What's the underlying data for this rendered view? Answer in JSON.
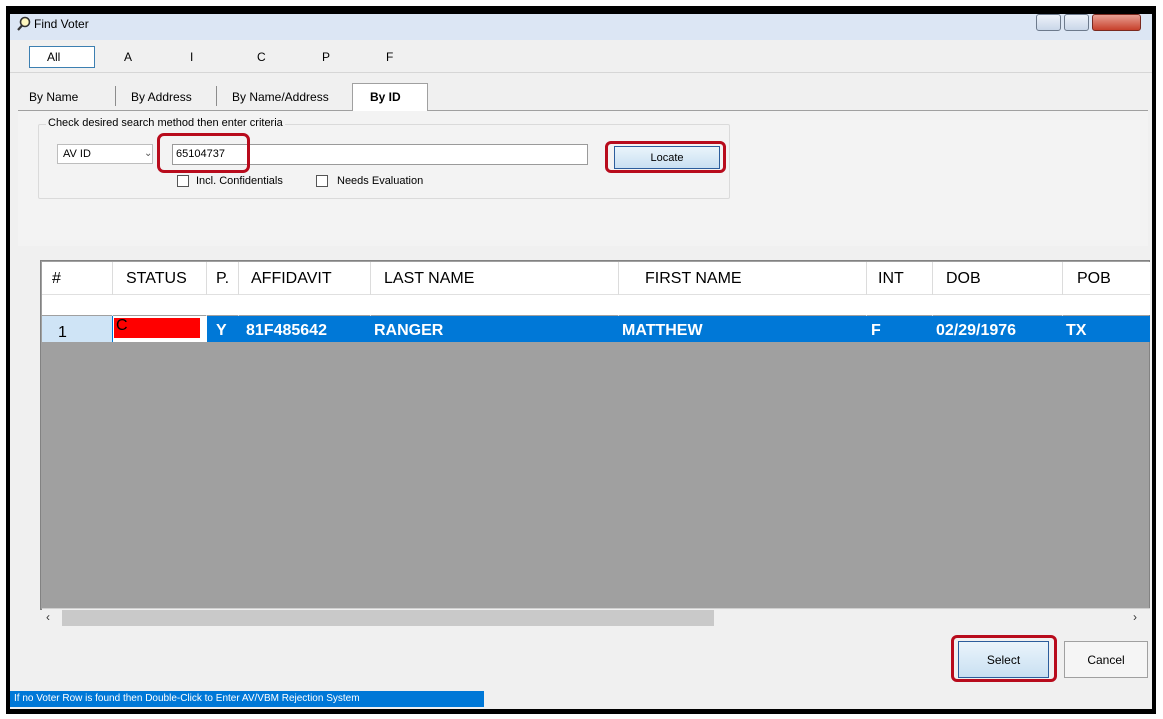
{
  "window": {
    "title": "Find Voter",
    "icon": "search-icon"
  },
  "filters": [
    "All",
    "A",
    "I",
    "C",
    "P",
    "F"
  ],
  "tabs": [
    "By Name",
    "By Address",
    "By Name/Address",
    "By ID"
  ],
  "active_tab": "By ID",
  "search": {
    "group_label": "Check desired search method then enter criteria",
    "method": "AV ID",
    "value": "65104737",
    "locate_label": "Locate",
    "incl_confidentials_label": "Incl. Confidentials",
    "incl_confidentials_checked": false,
    "needs_evaluation_label": "Needs Evaluation",
    "needs_evaluation_checked": false
  },
  "grid": {
    "columns": [
      "#",
      "STATUS",
      "P.",
      "AFFIDAVIT",
      "LAST NAME",
      "FIRST NAME",
      "INT",
      "DOB",
      "POB"
    ],
    "rows": [
      {
        "num": "1",
        "status": "C",
        "p": "Y",
        "affidavit": "81F485642",
        "last_name": "RANGER",
        "first_name": "MATTHEW",
        "int": "F",
        "dob": "02/29/1976",
        "pob": "TX"
      }
    ]
  },
  "buttons": {
    "select": "Select",
    "cancel": "Cancel"
  },
  "status_bar": "If no Voter Row is found then Double-Click to Enter AV/VBM Rejection System",
  "colors": {
    "highlight": "#b80b1c",
    "selection": "#0078d7",
    "status_red": "#ff0000"
  }
}
